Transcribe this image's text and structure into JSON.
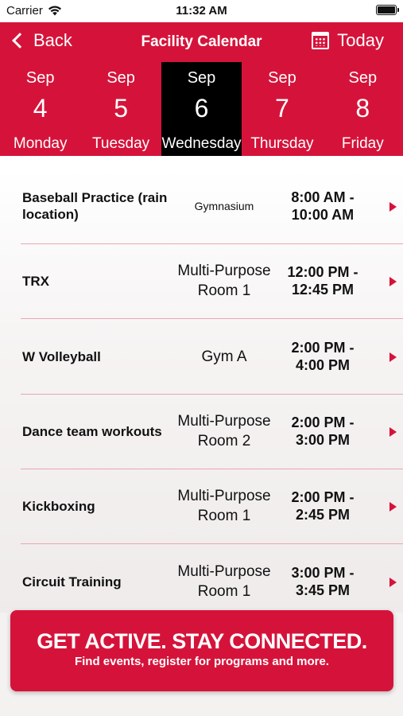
{
  "status_bar": {
    "carrier": "Carrier",
    "time": "11:32 AM"
  },
  "nav": {
    "back_label": "Back",
    "title": "Facility Calendar",
    "today_label": "Today"
  },
  "colors": {
    "brand_red": "#d5133a",
    "selected_day_bg": "#000000"
  },
  "days": [
    {
      "month": "Sep",
      "date": "4",
      "weekday": "Monday",
      "selected": false
    },
    {
      "month": "Sep",
      "date": "5",
      "weekday": "Tuesday",
      "selected": false
    },
    {
      "month": "Sep",
      "date": "6",
      "weekday": "Wednesday",
      "selected": true
    },
    {
      "month": "Sep",
      "date": "7",
      "weekday": "Thursday",
      "selected": false
    },
    {
      "month": "Sep",
      "date": "8",
      "weekday": "Friday",
      "selected": false
    }
  ],
  "events": [
    {
      "name": "Baseball Practice (rain location)",
      "location": "Gymnasium",
      "time": "8:00 AM -\n10:00 AM"
    },
    {
      "name": "TRX",
      "location": "Multi-Purpose Room 1",
      "time": "12:00 PM -\n12:45 PM"
    },
    {
      "name": "W Volleyball",
      "location": "Gym A",
      "time": "2:00 PM -\n4:00 PM"
    },
    {
      "name": "Dance team workouts",
      "location": "Multi-Purpose Room 2",
      "time": "2:00 PM -\n3:00 PM"
    },
    {
      "name": "Kickboxing",
      "location": "Multi-Purpose Room 1",
      "time": "2:00 PM -\n2:45 PM"
    },
    {
      "name": "Circuit Training",
      "location": "Multi-Purpose Room 1",
      "time": "3:00 PM -\n3:45 PM"
    }
  ],
  "banner": {
    "headline": "GET ACTIVE.  STAY CONNECTED.",
    "subtext": "Find events, register for programs and more."
  }
}
